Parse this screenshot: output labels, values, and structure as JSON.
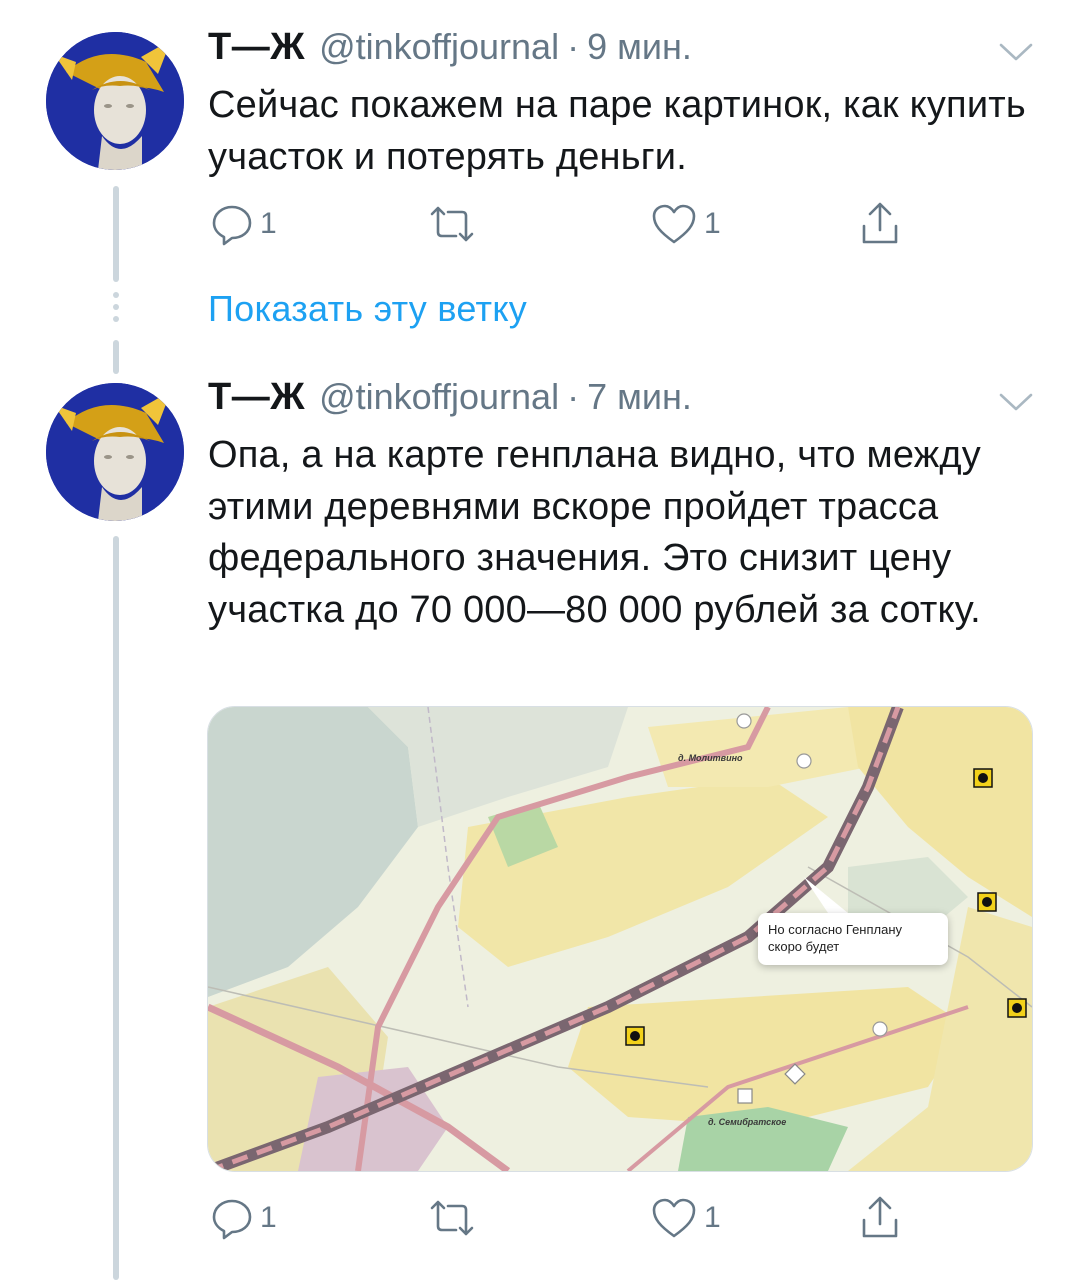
{
  "tweets": [
    {
      "author": "Т—Ж",
      "handle": "@tinkoffjournal",
      "separator": "·",
      "time": "9 мин.",
      "text": "Сейчас покажем на паре картинок, как купить участок и потерять деньги.",
      "replies": "1",
      "retweets": "",
      "likes": "1"
    },
    {
      "author": "Т—Ж",
      "handle": "@tinkoffjournal",
      "separator": "·",
      "time": "7 мин.",
      "text": "Опа, а на карте генплана видно, что между этими деревнями вскоре пройдет трасса федерального значения. Это снизит цену участка до 70 000—80 000 рублей за сотку.",
      "replies": "1",
      "retweets": "",
      "likes": "1",
      "media": {
        "callout": "Но согласно Генплану скоро будет",
        "village_top": "д. Молитвино",
        "village_bottom": "д. Семибратское"
      }
    }
  ],
  "show_thread": "Показать эту ветку",
  "icons": {
    "reply": "reply-icon",
    "retweet": "retweet-icon",
    "like": "like-icon",
    "share": "share-icon",
    "menu": "chevron-down-icon"
  },
  "colors": {
    "link": "#1da1f2",
    "secondary_text": "#657786",
    "thread_line": "#ccd6dd",
    "avatar_bg": "#1f2fa3"
  }
}
